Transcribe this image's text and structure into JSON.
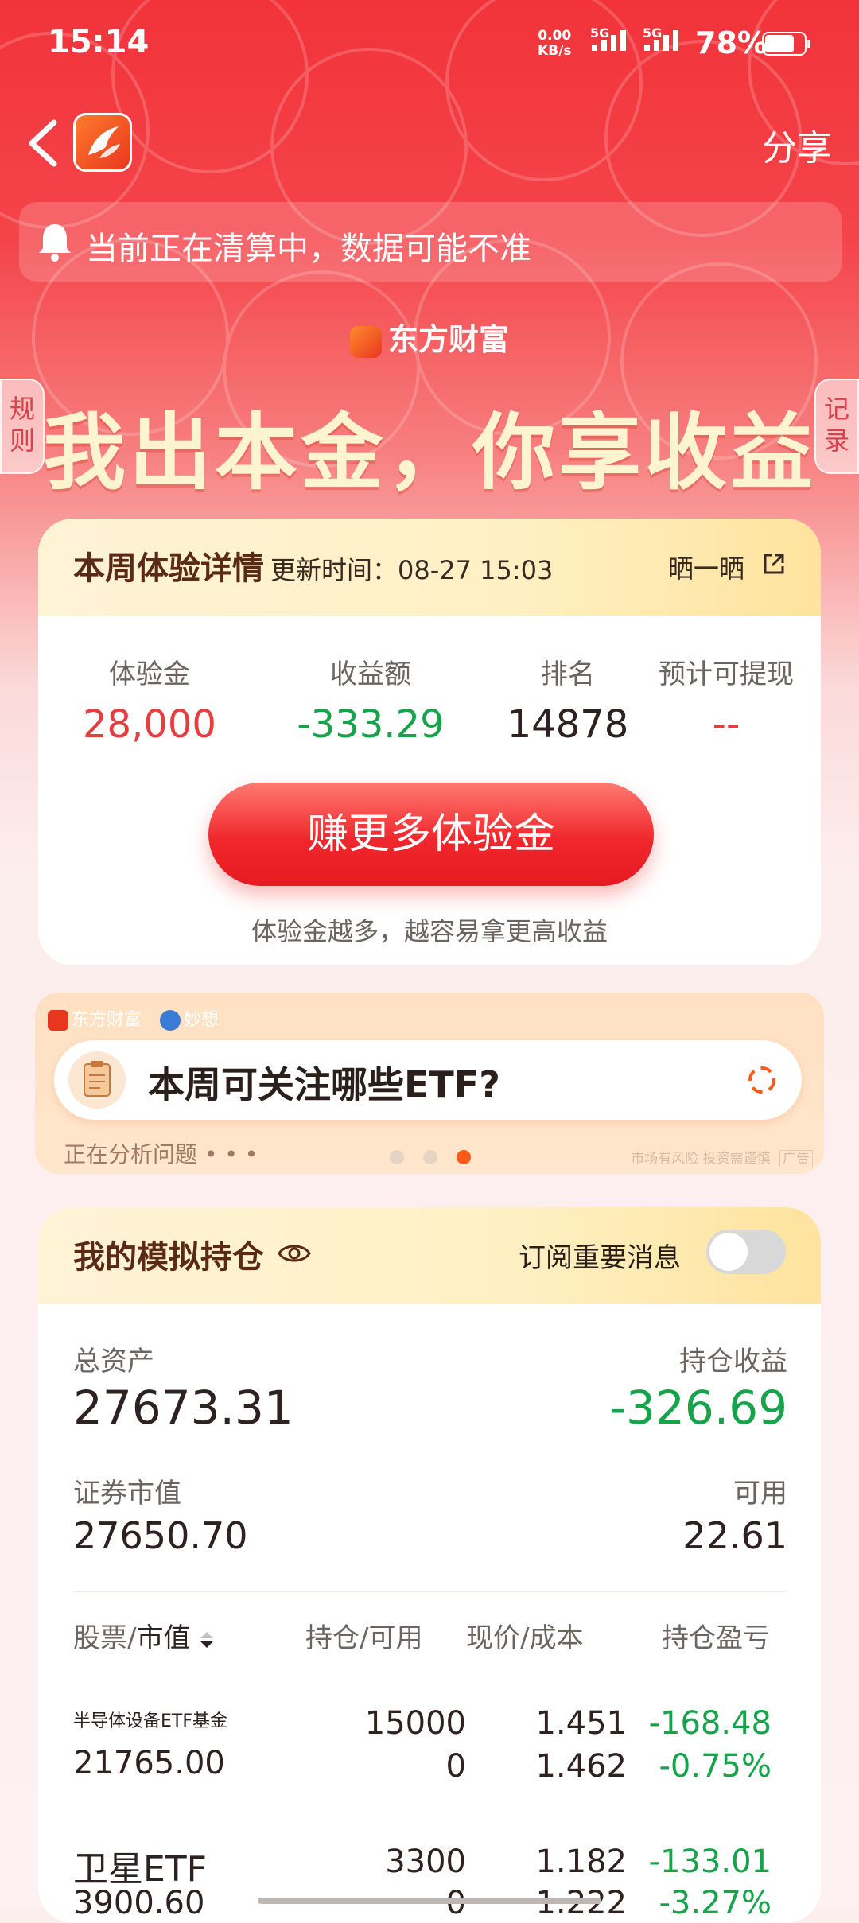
{
  "status_bar": {
    "time": "15:14",
    "net_speed": "0.00",
    "net_unit": "KB/s",
    "sim1": "5G",
    "sim2": "5G",
    "battery": "78%"
  },
  "nav": {
    "share_label": "分享"
  },
  "notice": {
    "text": "当前正在清算中，数据可能不准"
  },
  "banner": {
    "brand": "东方财富",
    "slogan": "我出本金，你享收益",
    "left_tab": "规则",
    "right_tab": "记录"
  },
  "weekly": {
    "title": "本周体验详情",
    "updated": "更新时间：08-27 15:03",
    "share_label": "晒一晒",
    "stats": [
      {
        "label": "体验金",
        "value": "28,000",
        "tone": "red"
      },
      {
        "label": "收益额",
        "value": "-333.29",
        "tone": "green"
      },
      {
        "label": "排名",
        "value": "14878",
        "tone": "dark"
      },
      {
        "label": "预计可提现",
        "value": "--",
        "tone": "red"
      }
    ],
    "earn_button": "赚更多体验金",
    "tip": "体验金越多，越容易拿更高收益"
  },
  "ad": {
    "brand1": "东方财富",
    "brand2": "妙想",
    "question": "本周可关注哪些ETF?",
    "analyzing": "正在分析问题 • • •",
    "risk": "市场有风险 投资需谨慎",
    "ad_tag": "广告",
    "active_dot": 2
  },
  "portfolio": {
    "title": "我的模拟持仓",
    "subscribe_label": "订阅重要消息",
    "subscribe_on": false,
    "total_assets_label": "总资产",
    "total_assets": "27673.31",
    "holding_pnl_label": "持仓收益",
    "holding_pnl": "-326.69",
    "market_value_label": "证券市值",
    "market_value": "27650.70",
    "available_label": "可用",
    "available": "22.61",
    "columns": {
      "c1a": "股票/",
      "c1b": "市值",
      "c2": "持仓/可用",
      "c3": "现价/成本",
      "c4": "持仓盈亏"
    },
    "rows": [
      {
        "name": "半导体设备ETF基金",
        "value": "21765.00",
        "position": "15000",
        "available": "0",
        "price": "1.451",
        "cost": "1.462",
        "pnl": "-168.48",
        "pnl_pct": "-0.75%"
      },
      {
        "name": "卫星ETF",
        "value": "3900.60",
        "position": "3300",
        "available": "0",
        "price": "1.182",
        "cost": "1.222",
        "pnl": "-133.01",
        "pnl_pct": "-3.27%"
      }
    ]
  }
}
